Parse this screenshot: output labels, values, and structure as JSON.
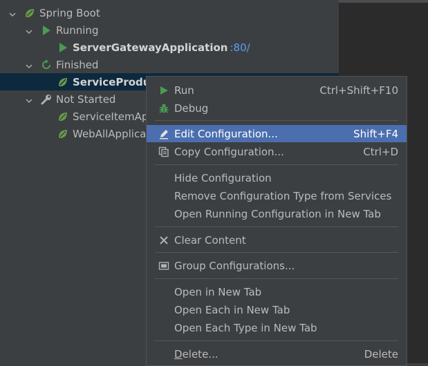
{
  "tree": {
    "spring_boot": "Spring Boot",
    "running": "Running",
    "gateway_app": "ServerGatewayApplication",
    "gateway_port": ":80/",
    "finished": "Finished",
    "service_product": "ServiceProduc",
    "not_started": "Not Started",
    "service_item": "ServiceItemAp",
    "web_all": "WebAllApplica"
  },
  "menu": {
    "run": {
      "label": "Run",
      "shortcut": "Ctrl+Shift+F10"
    },
    "debug": {
      "label": "Debug"
    },
    "edit_config": {
      "label": "Edit Configuration...",
      "shortcut": "Shift+F4"
    },
    "copy_config": {
      "label": "Copy Configuration...",
      "shortcut": "Ctrl+D"
    },
    "hide_config": {
      "label": "Hide Configuration"
    },
    "remove_type": {
      "label": "Remove Configuration Type from Services"
    },
    "open_running": {
      "label": "Open Running Configuration in New Tab"
    },
    "clear_content": {
      "label": "Clear Content"
    },
    "group_configs": {
      "label": "Group Configurations..."
    },
    "open_new_tab": {
      "label": "Open in New Tab"
    },
    "open_each": {
      "label": "Open Each in New Tab"
    },
    "open_each_type": {
      "label": "Open Each Type in New Tab"
    },
    "delete": {
      "label_first": "D",
      "label_rest": "elete...",
      "shortcut": "Delete"
    }
  },
  "colors": {
    "panel_bg": "#3c3f41",
    "editor_bg": "#2b2b2b",
    "selection": "#0d293e",
    "menu_highlight": "#4b6eaf",
    "run_green": "#499c54",
    "link_blue": "#589df6"
  },
  "icons": {
    "spring": "spring-leaf-icon",
    "run": "play-icon",
    "finished": "rerun-icon",
    "not_started": "wrench-icon",
    "debug": "bug-icon",
    "edit": "pencil-icon",
    "copy": "copy-icon",
    "clear": "close-icon",
    "group": "folder-icon"
  }
}
